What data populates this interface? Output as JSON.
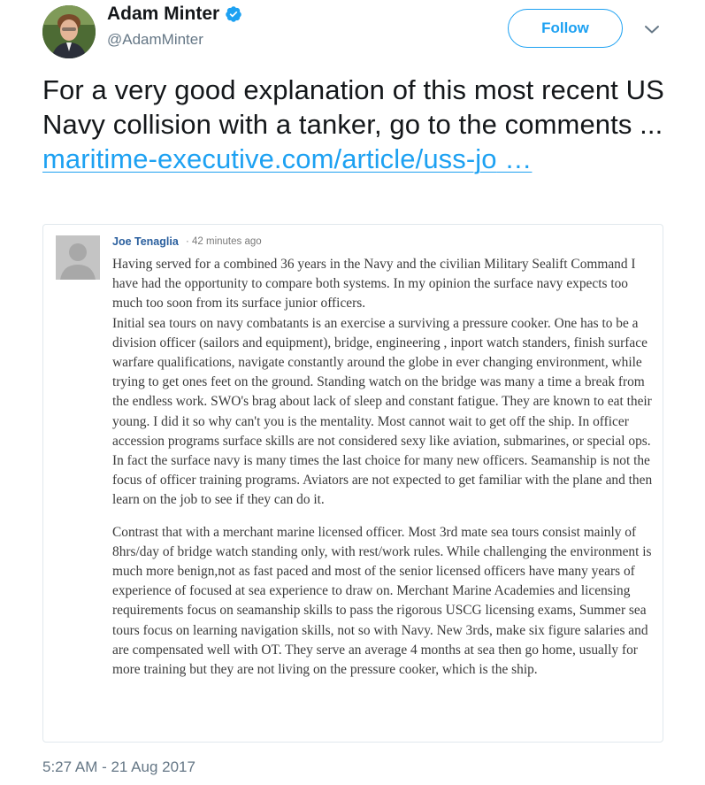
{
  "user": {
    "name": "Adam Minter",
    "handle": "@AdamMinter",
    "verified_icon": "verified-badge-icon",
    "avatar": "avatar-photo"
  },
  "actions": {
    "follow_label": "Follow",
    "more_icon": "chevron-down-icon"
  },
  "tweet": {
    "text": "For a very good explanation of this most recent US Navy collision with a tanker, go to the comments ... ",
    "link_text": "maritime-executive.com/article/uss-jo",
    "link_ellipsis": " …",
    "timestamp": "5:27 AM - 21 Aug 2017"
  },
  "comment": {
    "author": "Joe Tenaglia",
    "time": "· 42 minutes ago",
    "paragraph_1": "Having served for a combined 36 years in the Navy and the civilian Military Sealift Command I have had the opportunity to compare both systems. In my opinion the surface navy expects too much too soon from its surface junior officers.",
    "paragraph_2": "Initial sea tours on navy combatants is an exercise a surviving a pressure cooker. One has to be a division officer (sailors and equipment), bridge, engineering , inport watch standers, finish surface warfare qualifications, navigate constantly around the globe in ever changing environment, while trying to get ones feet on the ground. Standing watch on the bridge was many a time a break from the endless work. SWO's brag about lack of sleep and constant fatigue. They are known to eat their young. I did it so why can't you is the mentality. Most cannot wait to get off the ship. In officer accession programs surface skills are not considered sexy like aviation, submarines, or special ops. In fact the surface navy is many times the last choice for many new officers. Seamanship is not the focus of officer training programs. Aviators are not expected to get familiar with the plane and then learn on the job to see if they can do it.",
    "paragraph_3": "Contrast that with a merchant marine licensed officer. Most 3rd mate sea tours consist mainly of 8hrs/day of bridge watch standing only, with rest/work rules. While challenging the environment is much more benign,not as fast paced and most of the senior licensed officers have many years of experience of focused at sea experience to draw on. Merchant Marine Academies and licensing requirements focus on seamanship skills to pass the rigorous USCG licensing exams, Summer sea tours focus on learning navigation skills, not so with Navy. New 3rds, make six figure salaries and are compensated well with OT. They serve an average 4 months at sea then go home, usually for more training but they are not living on the pressure cooker, which is the ship."
  },
  "colors": {
    "accent": "#1da1f2",
    "text": "#14171a",
    "muted": "#657786",
    "comment_author": "#2a5f9e"
  }
}
